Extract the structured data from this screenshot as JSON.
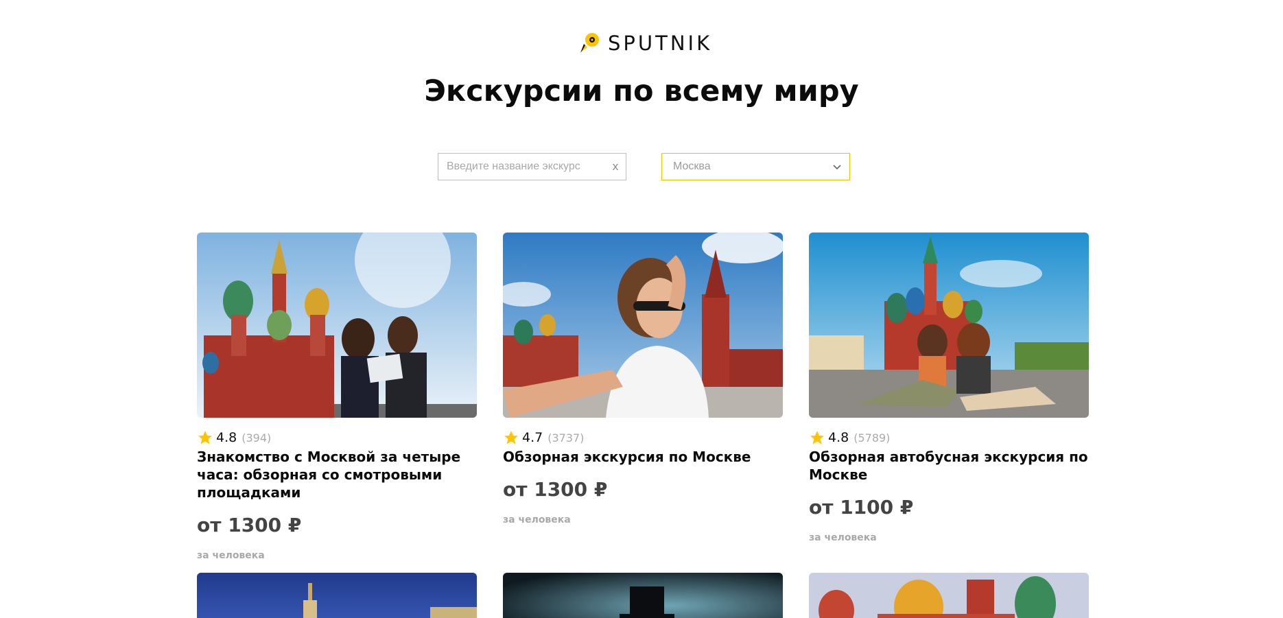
{
  "brand": {
    "name": "SPUTNIK",
    "accent": "#FFC400"
  },
  "page": {
    "title": "Экскурсии по всему миру"
  },
  "search": {
    "placeholder": "Введите название экскурс",
    "clear_label": "x"
  },
  "city_filter": {
    "selected": "Москва"
  },
  "tours": [
    {
      "rating": "4.8",
      "reviews": "(394)",
      "title": "Знакомство с Москвой за четыре часа: обзорная со смотровыми площадками",
      "price": "от 1300 ₽",
      "per": "за человека"
    },
    {
      "rating": "4.7",
      "reviews": "(3737)",
      "title": "Обзорная экскурсия по Москве",
      "price": "от 1300 ₽",
      "per": "за человека"
    },
    {
      "rating": "4.8",
      "reviews": "(5789)",
      "title": "Обзорная автобусная экскурсия по Москве",
      "price": "от 1100 ₽",
      "per": "за человека"
    }
  ],
  "icons": {
    "logo": "sputnik-logo-icon",
    "star": "star-icon",
    "chevron": "chevron-down-icon"
  }
}
